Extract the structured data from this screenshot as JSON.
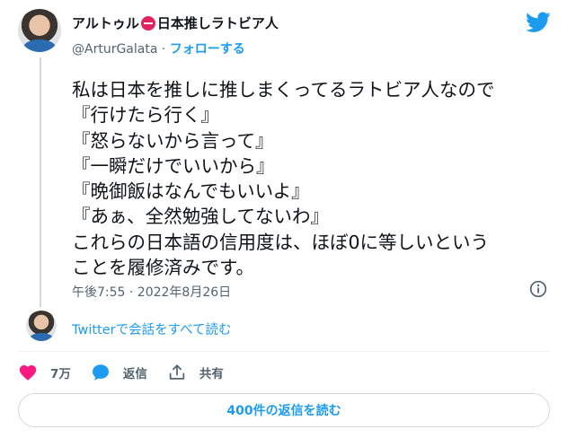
{
  "author": {
    "name_part1": "アルトゥル",
    "name_part2": "日本推しラトビア人",
    "handle": "@ArturGalata",
    "separator": "·",
    "follow_label": "フォローする"
  },
  "tweet": {
    "text": "私は日本を推しに推しまくってるラトビア人なので\n『行けたら行く』\n『怒らないから言って』\n『一瞬だけでいいから』\n『晩御飯はなんでもいいよ』\n『あぁ、全然勉強してないわ』\nこれらの日本語の信用度は、ほぼ0に等しいという\nことを履修済みです。",
    "timestamp": "午後7:55 · 2022年8月26日"
  },
  "conversation": {
    "label": "Twitterで会話をすべて読む"
  },
  "actions": {
    "like_count": "7万",
    "reply_label": "返信",
    "share_label": "共有"
  },
  "replies_button": {
    "label": "400件の返信を読む"
  },
  "colors": {
    "accent": "#1d9bf0",
    "like": "#f91880",
    "text": "#0f1419",
    "muted": "#536471"
  },
  "icons": [
    "twitter-bird-icon",
    "no-entry-icon",
    "info-icon",
    "heart-icon",
    "reply-bubble-icon",
    "share-icon"
  ]
}
